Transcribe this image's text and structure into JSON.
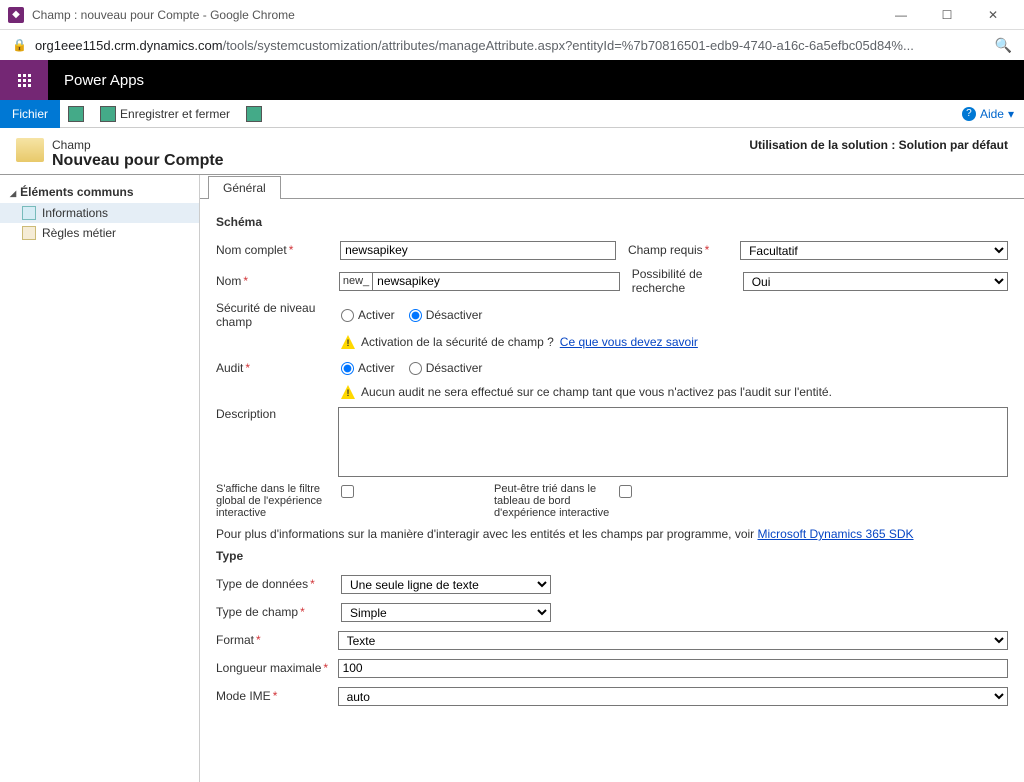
{
  "chrome": {
    "title": "Champ : nouveau pour Compte - Google Chrome",
    "url_domain": "org1eee115d.crm.dynamics.com",
    "url_path": "/tools/systemcustomization/attributes/manageAttribute.aspx?entityId=%7b70816501-edb9-4740-a16c-6a5efbc05d84%..."
  },
  "app": {
    "name": "Power Apps"
  },
  "toolbar": {
    "file": "Fichier",
    "save_close": "Enregistrer et fermer",
    "help": "Aide"
  },
  "page_header": {
    "small": "Champ",
    "big": "Nouveau pour Compte",
    "solution_context": "Utilisation de la solution : Solution par défaut"
  },
  "nav": {
    "section": "Éléments communs",
    "items": {
      "info": "Informations",
      "rules": "Règles métier"
    }
  },
  "tabs": {
    "general": "Général"
  },
  "form": {
    "schema_h": "Schéma",
    "display_name_label": "Nom complet",
    "display_name_value": "newsapikey",
    "requirement_label": "Champ requis",
    "requirement_value": "Facultatif",
    "name_label": "Nom",
    "name_prefix": "new_",
    "name_value": "newsapikey",
    "searchable_label": "Possibilité de recherche",
    "searchable_value": "Oui",
    "field_security_label": "Sécurité de niveau champ",
    "activate": "Activer",
    "deactivate": "Désactiver",
    "fs_info_text": "Activation de la sécurité de champ ?",
    "fs_info_link": "Ce que vous devez savoir",
    "audit_label": "Audit",
    "audit_info": "Aucun audit ne sera effectué sur ce champ tant que vous n'activez pas l'audit sur l'entité.",
    "description_label": "Description",
    "global_filter_label": "S'affiche dans le filtre global de l'expérience interactive",
    "sortable_label": "Peut-être trié dans le tableau de bord d'expérience interactive",
    "sdk_text": "Pour plus d'informations sur la manière d'interagir avec les entités et les champs par programme, voir",
    "sdk_link": "Microsoft Dynamics 365 SDK",
    "type_h": "Type",
    "data_type_label": "Type de données",
    "data_type_value": "Une seule ligne de texte",
    "field_type_label": "Type de champ",
    "field_type_value": "Simple",
    "format_label": "Format",
    "format_value": "Texte",
    "maxlen_label": "Longueur maximale",
    "maxlen_value": "100",
    "ime_label": "Mode IME",
    "ime_value": "auto"
  }
}
